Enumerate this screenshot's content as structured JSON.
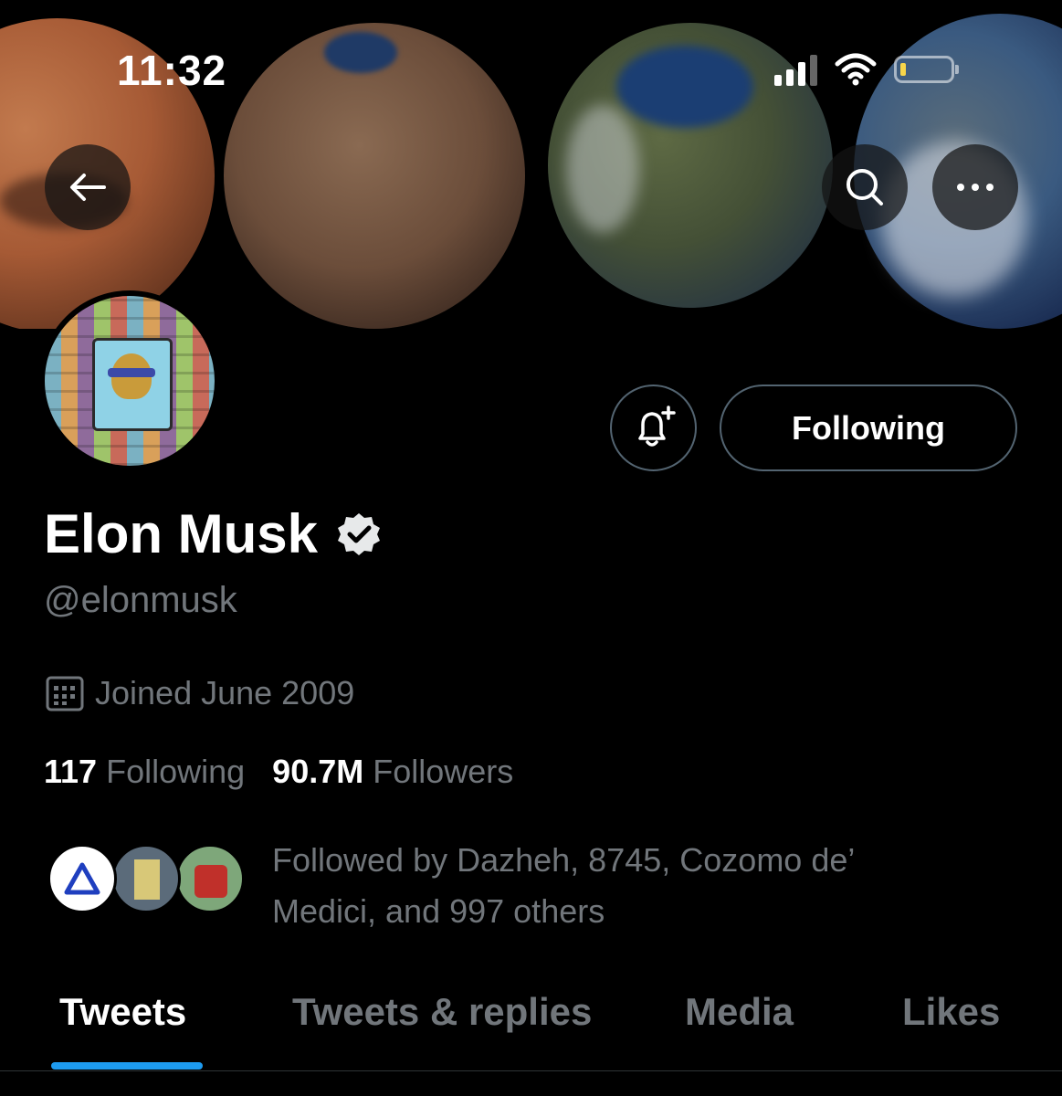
{
  "status_bar": {
    "time": "11:32",
    "signal_icon": "cellular-signal-icon",
    "wifi_icon": "wifi-icon",
    "battery_icon": "battery-low-icon",
    "battery_color": "#f7d54a"
  },
  "header": {
    "back_icon": "arrow-left-icon",
    "search_icon": "search-icon",
    "more_icon": "more-horizontal-icon"
  },
  "profile": {
    "name": "Elon Musk",
    "handle": "@elonmusk",
    "verified_icon": "verified-badge-icon",
    "joined": "Joined June 2009",
    "joined_icon": "calendar-icon",
    "following_count": "117",
    "following_label": "Following",
    "followers_count": "90.7M",
    "followers_label": "Followers",
    "followed_by": "Followed by Dazheh, 8745, Cozomo de’ Medici, and 997 others"
  },
  "actions": {
    "notify_icon": "bell-plus-icon",
    "following_button": "Following"
  },
  "tabs": [
    {
      "label": "Tweets",
      "active": true
    },
    {
      "label": "Tweets & replies",
      "active": false
    },
    {
      "label": "Media",
      "active": false
    },
    {
      "label": "Likes",
      "active": false
    }
  ],
  "colors": {
    "accent": "#1d9bf0",
    "muted_text": "#71767b",
    "background": "#000000"
  }
}
